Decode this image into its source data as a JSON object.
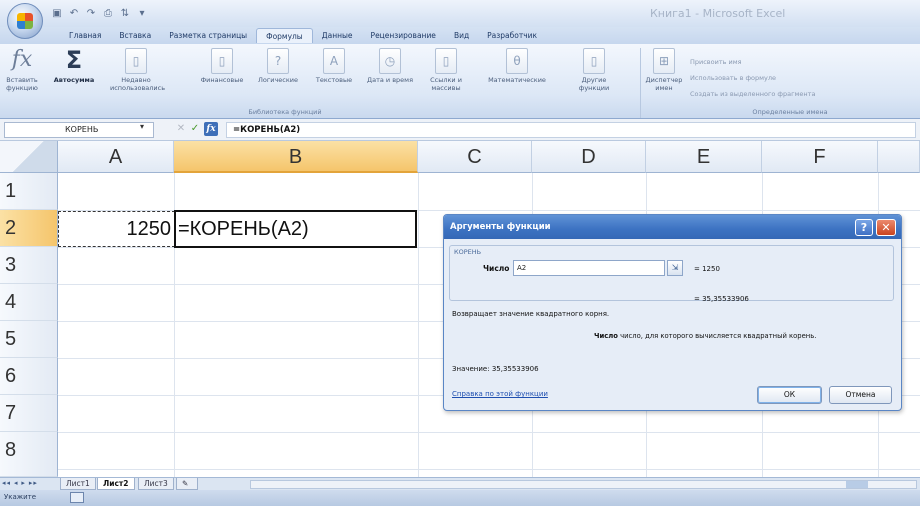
{
  "window": {
    "title": "Книга1 - Microsoft Excel"
  },
  "ribbon": {
    "tabs": [
      "Главная",
      "Вставка",
      "Разметка страницы",
      "Формулы",
      "Данные",
      "Рецензирование",
      "Вид",
      "Разработчик"
    ],
    "active_tab": "Формулы",
    "buttons": [
      {
        "label": "Вставить функцию",
        "icon": "fx-icon"
      },
      {
        "label": "Автосумма",
        "icon": "sigma-icon"
      },
      {
        "label": "Недавно использовались",
        "icon": "book-icon"
      },
      {
        "label": "Финансовые",
        "icon": "book-icon"
      },
      {
        "label": "Логические",
        "icon": "book-icon"
      },
      {
        "label": "Текстовые",
        "icon": "book-icon"
      },
      {
        "label": "Дата и время",
        "icon": "book-icon"
      },
      {
        "label": "Ссылки и массивы",
        "icon": "book-icon"
      },
      {
        "label": "Математические",
        "icon": "book-icon"
      },
      {
        "label": "Другие функции",
        "icon": "book-icon"
      },
      {
        "label": "Диспетчер имен",
        "icon": "name-manager-icon"
      }
    ],
    "group_library": "Библиотека функций",
    "group_names": "Определенные имена",
    "names_items": [
      "Присвоить имя",
      "Использовать в формуле",
      "Создать из выделенного фрагмента"
    ]
  },
  "formula_bar": {
    "name_box": "КОРЕНЬ",
    "cancel": "✕",
    "enter": "✓",
    "fx": "fx",
    "formula": "=КОРЕНЬ(A2)"
  },
  "grid": {
    "columns": [
      "A",
      "B",
      "C",
      "D",
      "E",
      "F"
    ],
    "selected_column": "B",
    "rows": [
      "1",
      "2",
      "3",
      "4",
      "5",
      "6",
      "7",
      "8"
    ],
    "selected_row": "2",
    "cells": {
      "A2": "1250",
      "B2": "=КОРЕНЬ(A2)"
    }
  },
  "dialog": {
    "title": "Аргументы функции",
    "help": "?",
    "close": "✕",
    "function_name": "КОРЕНЬ",
    "arg_label": "Число",
    "arg_value": "A2",
    "arg_result": "= 1250",
    "result": "= 35,35533906",
    "description": "Возвращает значение квадратного корня.",
    "arg_desc_name": "Число",
    "arg_desc_text": "число, для которого вычисляется квадратный корень.",
    "value_line": "Значение:  35,35533906",
    "help_link": "Справка по этой функции",
    "ok": "ОК",
    "cancel": "Отмена"
  },
  "sheets": {
    "nav": "◂◂ ◂ ▸ ▸▸",
    "tabs": [
      "Лист1",
      "Лист2",
      "Лист3"
    ],
    "active": "Лист2"
  },
  "status": {
    "mode": "Укажите"
  },
  "colors": {
    "accent_blue": "#3c72c2",
    "selected_header": "#f5c56b",
    "ribbon_bg": "#dce7f6"
  }
}
